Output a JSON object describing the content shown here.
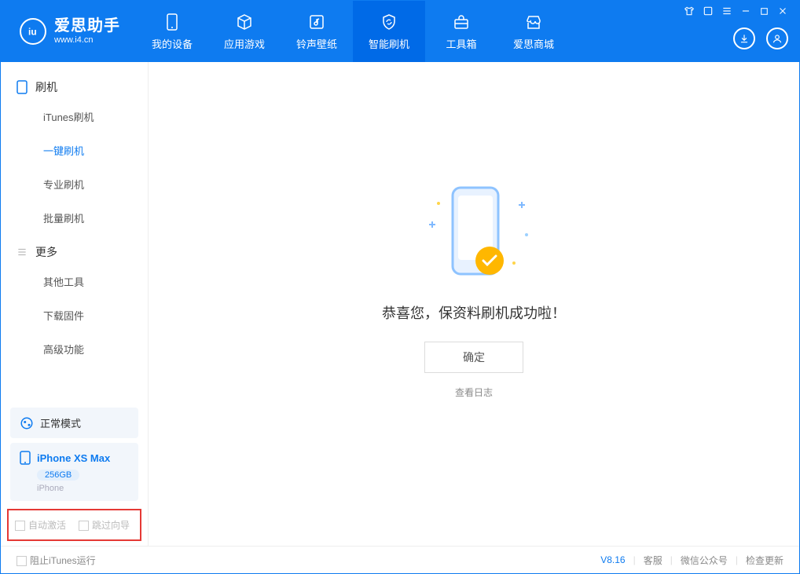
{
  "brand": {
    "name": "爱思助手",
    "url": "www.i4.cn"
  },
  "tabs": {
    "device": "我的设备",
    "apps": "应用游戏",
    "ringtone": "铃声壁纸",
    "flash": "智能刷机",
    "toolbox": "工具箱",
    "store": "爱思商城"
  },
  "sidebar": {
    "group_flash": "刷机",
    "items_flash": {
      "itunes": "iTunes刷机",
      "onekey": "一键刷机",
      "pro": "专业刷机",
      "batch": "批量刷机"
    },
    "group_more": "更多",
    "items_more": {
      "other": "其他工具",
      "fw": "下载固件",
      "adv": "高级功能"
    },
    "mode": "正常模式",
    "device": {
      "name": "iPhone XS Max",
      "capacity": "256GB",
      "type": "iPhone"
    },
    "cb1": "自动激活",
    "cb2": "跳过向导"
  },
  "main": {
    "message": "恭喜您，保资料刷机成功啦！",
    "ok": "确定",
    "log": "查看日志"
  },
  "footer": {
    "block_itunes": "阻止iTunes运行",
    "version": "V8.16",
    "service": "客服",
    "wechat": "微信公众号",
    "update": "检查更新"
  }
}
